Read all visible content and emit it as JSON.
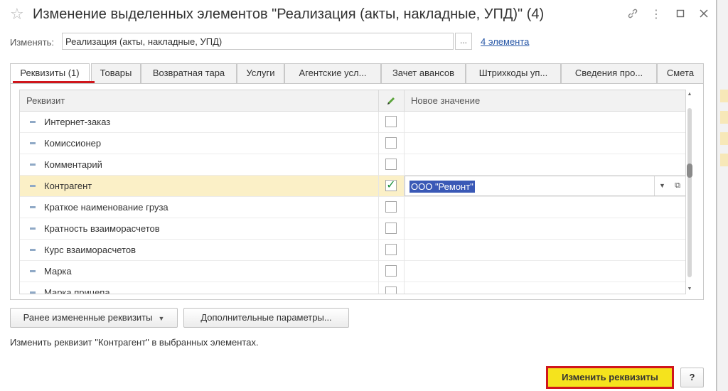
{
  "window": {
    "title": "Изменение выделенных элементов \"Реализация (акты, накладные, УПД)\" (4)",
    "icons": [
      "star-icon",
      "link-icon",
      "more-icon",
      "maximize-icon",
      "close-icon"
    ]
  },
  "target": {
    "label": "Изменять:",
    "value": "Реализация (акты, накладные, УПД)",
    "dots": "...",
    "link": "4 элемента"
  },
  "tabs": [
    {
      "label": "Реквизиты (1)",
      "active": true
    },
    {
      "label": "Товары"
    },
    {
      "label": "Возвратная тара"
    },
    {
      "label": "Услуги"
    },
    {
      "label": "Агентские усл..."
    },
    {
      "label": "Зачет авансов"
    },
    {
      "label": "Штрихкоды уп..."
    },
    {
      "label": "Сведения про..."
    },
    {
      "label": "Смета"
    }
  ],
  "grid": {
    "col_attr": "Реквизит",
    "col_value": "Новое значение",
    "rows": [
      {
        "name": "Интернет-заказ",
        "checked": false
      },
      {
        "name": "Комиссионер",
        "checked": false
      },
      {
        "name": "Комментарий",
        "checked": false
      },
      {
        "name": "Контрагент",
        "checked": true,
        "value": "ООО \"Ремонт\"",
        "selected": true
      },
      {
        "name": "Краткое наименование груза",
        "checked": false
      },
      {
        "name": "Кратность взаиморасчетов",
        "checked": false
      },
      {
        "name": "Курс взаиморасчетов",
        "checked": false
      },
      {
        "name": "Марка",
        "checked": false
      },
      {
        "name": "Марка прицепа",
        "checked": false
      }
    ]
  },
  "buttons": {
    "prev_changed": "Ранее измененные реквизиты",
    "extra_params": "Дополнительные параметры...",
    "apply": "Изменить реквизиты",
    "help": "?"
  },
  "hint": "Изменить реквизит \"Контрагент\" в выбранных элементах.",
  "colors": {
    "accent_red": "#d0161c",
    "primary_yellow": "#f5e31d",
    "selection_bg": "#fbf0c7",
    "link": "#2656a6"
  }
}
